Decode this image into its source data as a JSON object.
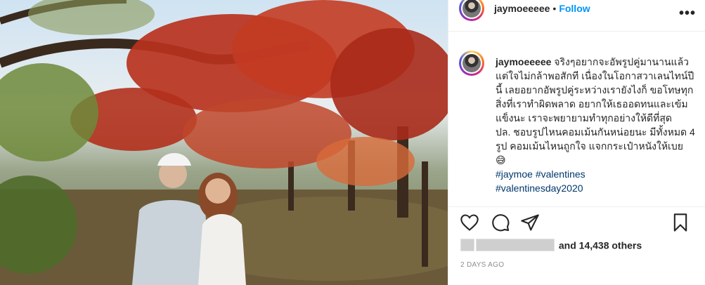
{
  "post": {
    "username": "jaymoeeeee",
    "follow_label": "Follow",
    "separator": "•",
    "more_label": "•••",
    "caption_user": "jaymoeeeee",
    "caption_text": "จริงๆอยากจะอัพรูปคู่มานานแล้ว แต่ใจไม่กล้าพอสักที เนื่องในโอกาสวาเลนไทน์ปีนี้ เลยอยากอัพรูปคู่ระหว่างเรายังไงก็ ขอโทษทุกสิ่งที่เราทำผิดพลาด อยากให้เธออดทนและเข้มแข็งนะ เราจะพยายามทำทุกอย่างให้ดีที่สุด",
    "caption_ps": "ปล. ชอบรูปไหนคอมเม้นกันหน่อยนะ มีทั้งหมด 4 รูป คอมเม้นไหนถูกใจ แจกกระเป๋าหนังให้เบย 😅",
    "hashtags": [
      "#jaymoe",
      "#valentines",
      "#valentinesday2020"
    ],
    "likes_text": "and 14,438 others",
    "time_ago": "2 DAYS AGO"
  },
  "icons": {
    "like": "heart-icon",
    "comment": "comment-icon",
    "share": "share-icon",
    "save": "bookmark-icon"
  },
  "colors": {
    "follow": "#0095f6",
    "hashtag": "#00376b",
    "muted": "#8e8e8e"
  }
}
